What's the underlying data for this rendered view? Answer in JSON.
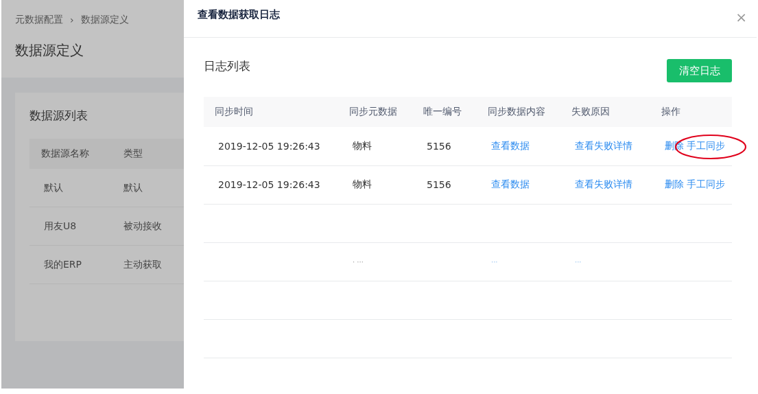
{
  "background_page": {
    "breadcrumb": [
      "元数据配置",
      "数据源定义"
    ],
    "breadcrumb_separator": "›",
    "title": "数据源定义",
    "card": {
      "title": "数据源列表",
      "columns": [
        "数据源名称",
        "类型"
      ],
      "rows": [
        [
          "默认",
          "默认"
        ],
        [
          "用友U8",
          "被动接收"
        ],
        [
          "我的ERP",
          "主动获取"
        ]
      ]
    }
  },
  "drawer": {
    "title": "查看数据获取日志",
    "close": "×",
    "section_title": "日志列表",
    "clear_button": "清空日志",
    "table": {
      "columns": [
        "同步时间",
        "同步元数据",
        "唯一编号",
        "同步数据内容",
        "失败原因",
        "操作"
      ],
      "rows": [
        {
          "kind": "record",
          "time": "2019-12-05 19:26:43",
          "metadata": "物料",
          "id": "5156",
          "content_link": "查看数据",
          "reason_link": "查看失败详情",
          "actions": [
            {
              "label": "删除",
              "circled": false
            },
            {
              "label": "手工同步",
              "circled": true
            }
          ]
        },
        {
          "kind": "record",
          "time": "2019-12-05 19:26:43",
          "metadata": "物料",
          "id": "5156",
          "content_link": "查看数据",
          "reason_link": "查看失败详情",
          "actions": [
            {
              "label": "删除",
              "circled": false
            },
            {
              "label": "手工同步",
              "circled": false
            }
          ]
        },
        {
          "kind": "empty"
        },
        {
          "kind": "faint",
          "metadata": "· ···",
          "content_link": "···",
          "reason_link": "···"
        },
        {
          "kind": "empty"
        },
        {
          "kind": "empty"
        }
      ]
    }
  }
}
